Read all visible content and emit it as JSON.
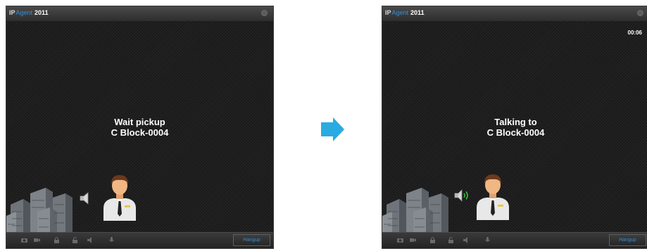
{
  "windows": [
    {
      "brand": {
        "ip": "IP",
        "agent": "Agent",
        "year": "2011"
      },
      "timer": "",
      "status": {
        "line1": "Wait pickup",
        "line2": "C Block-0004"
      },
      "toolbar": {
        "hangup_label": "Hangup"
      }
    },
    {
      "brand": {
        "ip": "IP",
        "agent": "Agent",
        "year": "2011"
      },
      "timer": "00:06",
      "status": {
        "line1": "Talking to",
        "line2": "C Block-0004"
      },
      "toolbar": {
        "hangup_label": "Hangup"
      }
    }
  ],
  "colors": {
    "arrow": "#29abe2",
    "accent": "#2f8fd8",
    "speaker_active": "#3fbf3f"
  },
  "icons": [
    "close-icon",
    "buildings-icon",
    "speaker-icon",
    "speaker-sound-waves-icon",
    "agent-person-icon",
    "camera-icon",
    "video-icon",
    "lock-icon",
    "unlock-icon",
    "volume-icon",
    "microphone-icon",
    "arrow-right-icon"
  ]
}
